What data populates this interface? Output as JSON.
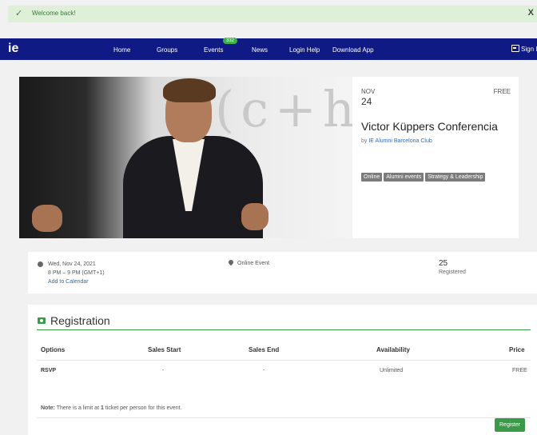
{
  "alert": {
    "message": "Welcome back!",
    "close": "X"
  },
  "nav": {
    "brand": "ie",
    "items": [
      "Home",
      "Groups",
      "Events",
      "News",
      "Login Help",
      "Download App"
    ],
    "events_badge": "332",
    "sign_in": "Sign I"
  },
  "event": {
    "month": "NOV",
    "day": "24",
    "price": "FREE",
    "title": "Victor Küppers Conferencia",
    "by_prefix": "by",
    "organizer": "IE Alumni Barcelona Club",
    "tags": [
      "Online",
      "Alumni events",
      "Strategy & Leadership"
    ],
    "image_text": "(c+h)"
  },
  "details": {
    "date": "Wed, Nov 24, 2021",
    "time": "8 PM – 9 PM (GMT+1)",
    "add_calendar": "Add to Calendar",
    "location": "Online Event",
    "registered_count": "25",
    "registered_label": "Registered"
  },
  "registration": {
    "title": "Registration",
    "headers": [
      "Options",
      "Sales Start",
      "Sales End",
      "Availability",
      "Price"
    ],
    "row": [
      "RSVP",
      "-",
      "-",
      "Unlimited",
      "FREE"
    ],
    "note_label": "Note:",
    "note_pre": "There is a limit at",
    "note_count": "1",
    "note_post": "ticket per person for this event.",
    "register_button": "Register"
  },
  "colors": {
    "navbar": "#0f1a85",
    "accent_green": "#3a9a47",
    "alert_bg": "#dff0d8"
  }
}
